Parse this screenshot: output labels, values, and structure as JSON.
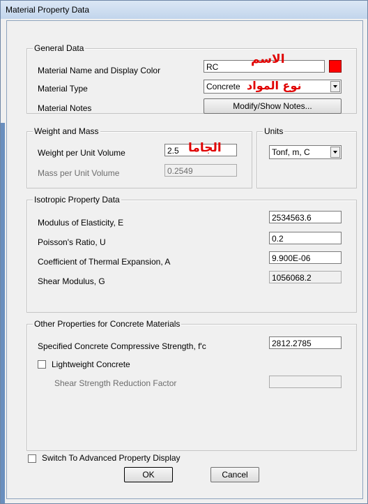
{
  "window": {
    "title": "Material Property Data"
  },
  "general_data": {
    "legend": "General Data",
    "name_label": "Material Name and Display Color",
    "name_value": "RC",
    "display_color": "#ff0000",
    "type_label": "Material Type",
    "type_value": "Concrete",
    "notes_label": "Material Notes",
    "notes_button": "Modify/Show Notes...",
    "ar_name": "الاسم",
    "ar_type": "نوع المواد"
  },
  "weight_mass": {
    "legend": "Weight and Mass",
    "weight_label": "Weight per Unit Volume",
    "weight_value": "2.5",
    "mass_label": "Mass per Unit Volume",
    "mass_value": "0.2549",
    "ar_weight": "الجاما"
  },
  "units": {
    "legend": "Units",
    "value": "Tonf, m, C"
  },
  "isotropic": {
    "legend": "Isotropic Property Data",
    "e_label": "Modulus of Elasticity,  E",
    "e_value": "2534563.6",
    "u_label": "Poisson's Ratio,  U",
    "u_value": "0.2",
    "a_label": "Coefficient of Thermal Expansion,  A",
    "a_value": "9.900E-06",
    "g_label": "Shear Modulus,  G",
    "g_value": "1056068.2"
  },
  "concrete": {
    "legend": "Other Properties for Concrete Materials",
    "fc_label": "Specified Concrete Compressive Strength, f'c",
    "fc_value": "2812.2785",
    "lightweight_label": "Lightweight Concrete",
    "lightweight_checked": false,
    "shear_label": "Shear Strength Reduction Factor",
    "shear_value": ""
  },
  "footer": {
    "advanced_label": "Switch To Advanced Property Display",
    "ok_label": "OK",
    "cancel_label": "Cancel"
  }
}
